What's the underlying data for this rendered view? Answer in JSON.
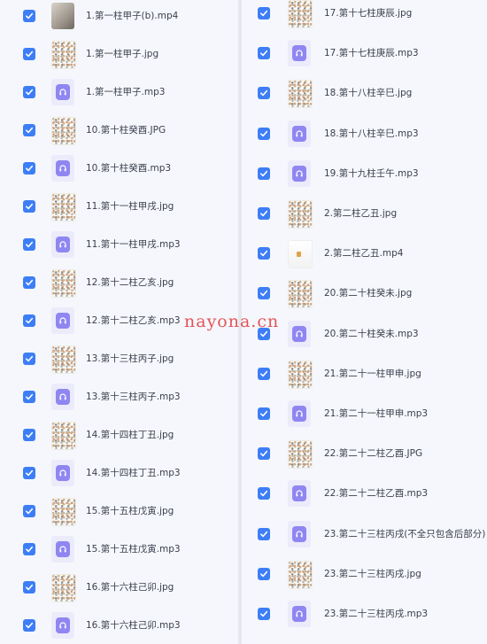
{
  "left_files": [
    {
      "name": "1.第一柱甲子(b).mp4",
      "kind": "video"
    },
    {
      "name": "1.第一柱甲子.jpg",
      "kind": "image"
    },
    {
      "name": "1.第一柱甲子.mp3",
      "kind": "audio"
    },
    {
      "name": "10.第十柱癸酉.JPG",
      "kind": "image"
    },
    {
      "name": "10.第十柱癸酉.mp3",
      "kind": "audio"
    },
    {
      "name": "11.第十一柱甲戌.jpg",
      "kind": "image"
    },
    {
      "name": "11.第十一柱甲戌.mp3",
      "kind": "audio"
    },
    {
      "name": "12.第十二柱乙亥.jpg",
      "kind": "image"
    },
    {
      "name": "12.第十二柱乙亥.mp3",
      "kind": "audio"
    },
    {
      "name": "13.第十三柱丙子.jpg",
      "kind": "image"
    },
    {
      "name": "13.第十三柱丙子.mp3",
      "kind": "audio"
    },
    {
      "name": "14.第十四柱丁丑.jpg",
      "kind": "image"
    },
    {
      "name": "14.第十四柱丁丑.mp3",
      "kind": "audio"
    },
    {
      "name": "15.第十五柱戊寅.jpg",
      "kind": "image"
    },
    {
      "name": "15.第十五柱戊寅.mp3",
      "kind": "audio"
    },
    {
      "name": "16.第十六柱己卯.jpg",
      "kind": "image"
    },
    {
      "name": "16.第十六柱己卯.mp3",
      "kind": "audio"
    }
  ],
  "right_files": [
    {
      "name": "17.第十七柱庚辰.jpg",
      "kind": "image"
    },
    {
      "name": "17.第十七柱庚辰.mp3",
      "kind": "audio"
    },
    {
      "name": "18.第十八柱辛巳.jpg",
      "kind": "image"
    },
    {
      "name": "18.第十八柱辛巳.mp3",
      "kind": "audio"
    },
    {
      "name": "19.第十九柱壬午.mp3",
      "kind": "audio"
    },
    {
      "name": "2.第二柱乙丑.jpg",
      "kind": "image"
    },
    {
      "name": "2.第二柱乙丑.mp4",
      "kind": "video-light"
    },
    {
      "name": "20.第二十柱癸未.jpg",
      "kind": "image"
    },
    {
      "name": "20.第二十柱癸未.mp3",
      "kind": "audio"
    },
    {
      "name": "21.第二十一柱甲申.jpg",
      "kind": "image"
    },
    {
      "name": "21.第二十一柱甲申.mp3",
      "kind": "audio"
    },
    {
      "name": "22.第二十二柱乙酉.JPG",
      "kind": "image"
    },
    {
      "name": "22.第二十二柱乙酉.mp3",
      "kind": "audio"
    },
    {
      "name": "23.第二十三柱丙戌(不全只包含后部分)",
      "kind": "audio"
    },
    {
      "name": "23.第二十三柱丙戌.jpg",
      "kind": "image"
    },
    {
      "name": "23.第二十三柱丙戌.mp3",
      "kind": "audio"
    }
  ],
  "watermark": "nayona.cn",
  "colors": {
    "checkbox": "#3d7ef6",
    "audio_icon": "#8f86f2",
    "watermark": "#e2474b"
  },
  "icons": {
    "checkbox": "checkmark-icon",
    "audio": "headphones-icon"
  }
}
